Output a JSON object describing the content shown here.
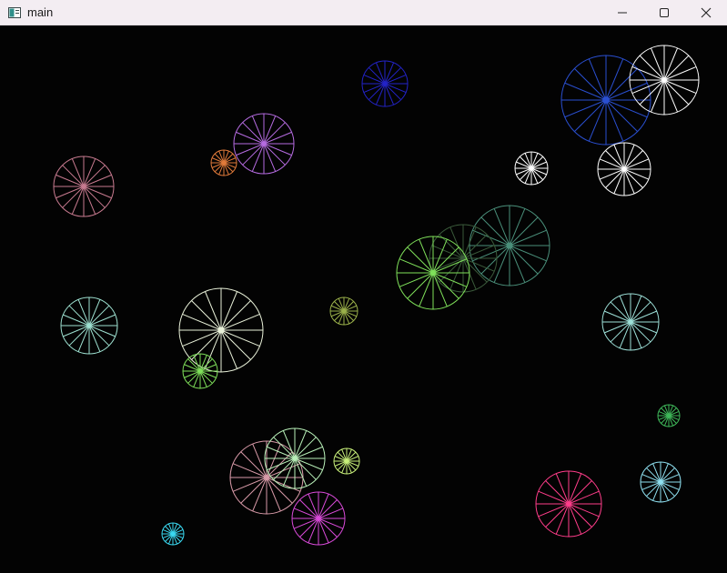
{
  "window": {
    "title": "main",
    "controls": [
      "minimize-icon",
      "maximize-icon",
      "close-icon"
    ]
  },
  "canvas": {
    "background": "#030303",
    "spoke_count": 16,
    "wheels": [
      {
        "color": "#2323c8"
      },
      {
        "color": "#2a4fd0"
      },
      {
        "color": "#ffffff"
      },
      {
        "color": "#b56be0"
      },
      {
        "color": "#e07a3a"
      },
      {
        "color": "#c77a8f"
      },
      {
        "color": "#ffffff"
      },
      {
        "color": "#ffffff"
      },
      {
        "color": "#4a8f7a"
      },
      {
        "color": "#3a5a3a"
      },
      {
        "color": "#7fe05a"
      },
      {
        "color": "#9de0d0"
      },
      {
        "color": "#e8f0d8"
      },
      {
        "color": "#9ab04a"
      },
      {
        "color": "#7fe05a"
      },
      {
        "color": "#9de0d8"
      },
      {
        "color": "#3fb85a"
      },
      {
        "color": "#d89aa8"
      },
      {
        "color": "#b8f0b8"
      },
      {
        "color": "#c8f07a"
      },
      {
        "color": "#d84ad8"
      },
      {
        "color": "#ff3d8a"
      },
      {
        "color": "#8fe0f0"
      },
      {
        "color": "#3ad8f0"
      }
    ]
  }
}
